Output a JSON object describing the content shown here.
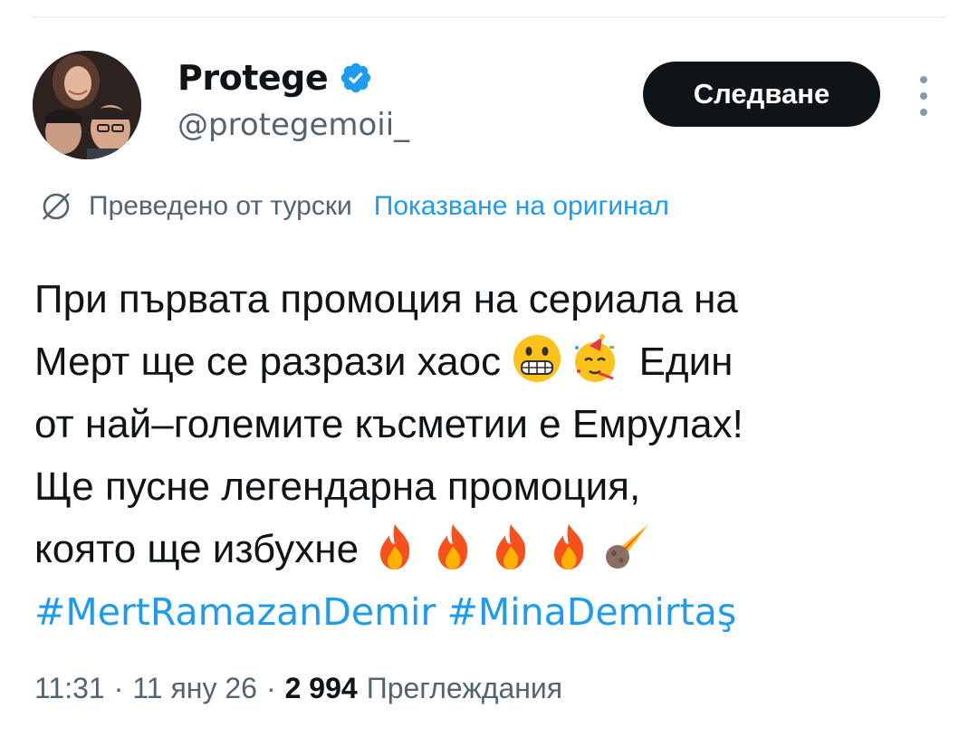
{
  "author": {
    "display_name": "Protege",
    "handle": "@protegemoii_",
    "verified_icon": "verified-badge-icon"
  },
  "actions": {
    "follow_label": "Следване",
    "more_icon": "more-vertical-icon"
  },
  "translation": {
    "icon": "globe-translate-icon",
    "label": "Преведено от турски",
    "show_original_label": "Показване на оригинал"
  },
  "tweet": {
    "line1": "При първата промоция на сериала на",
    "line2_text": "Мерт ще се разрази хаос",
    "line2_after": "Един",
    "line3": "от най–големите късметии е Емрулах!",
    "line4": "Ще пусне легендарна промоция,",
    "line5_text": "която ще избухне",
    "hashtag1": "#MertRamazanDemir",
    "hashtag2": "#MinaDemirtaş",
    "emojis": [
      "grimacing-face-emoji",
      "partying-face-emoji",
      "fire-emoji",
      "fire-emoji",
      "fire-emoji",
      "fire-emoji",
      "comet-emoji"
    ]
  },
  "meta": {
    "time": "11:31",
    "date": "11 яну 26",
    "views_count": "2 994",
    "views_label": "Преглеждания",
    "separator": "·"
  },
  "colors": {
    "link": "#1d9bf0",
    "text": "#0f1419",
    "secondary": "#536471",
    "button_bg": "#0f1419"
  }
}
